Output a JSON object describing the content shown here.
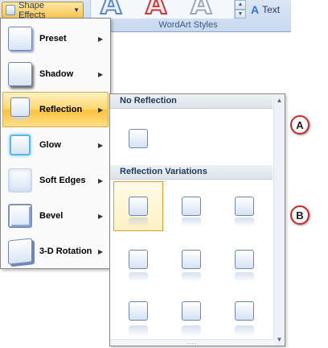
{
  "ribbon": {
    "shape_effects_label": "Shape Effects",
    "text_fill_label": "Text",
    "group_label": "WordArt Styles",
    "wordart_samples": [
      "A",
      "A",
      "A"
    ]
  },
  "menu": {
    "items": [
      {
        "label": "Preset",
        "icon": "preset-icon"
      },
      {
        "label": "Shadow",
        "icon": "shadow-icon"
      },
      {
        "label": "Reflection",
        "icon": "reflection-icon",
        "active": true
      },
      {
        "label": "Glow",
        "icon": "glow-icon"
      },
      {
        "label": "Soft Edges",
        "icon": "soft-edges-icon"
      },
      {
        "label": "Bevel",
        "icon": "bevel-icon"
      },
      {
        "label": "3-D Rotation",
        "icon": "3d-rotation-icon"
      }
    ]
  },
  "submenu": {
    "section_none": "No Reflection",
    "section_variations": "Reflection Variations",
    "grip": "...."
  },
  "callouts": {
    "a": "A",
    "b": "B"
  },
  "colors": {
    "accent_highlight": "#ffc13c",
    "callout_ring": "#c8282a",
    "menu_border": "#868686"
  }
}
